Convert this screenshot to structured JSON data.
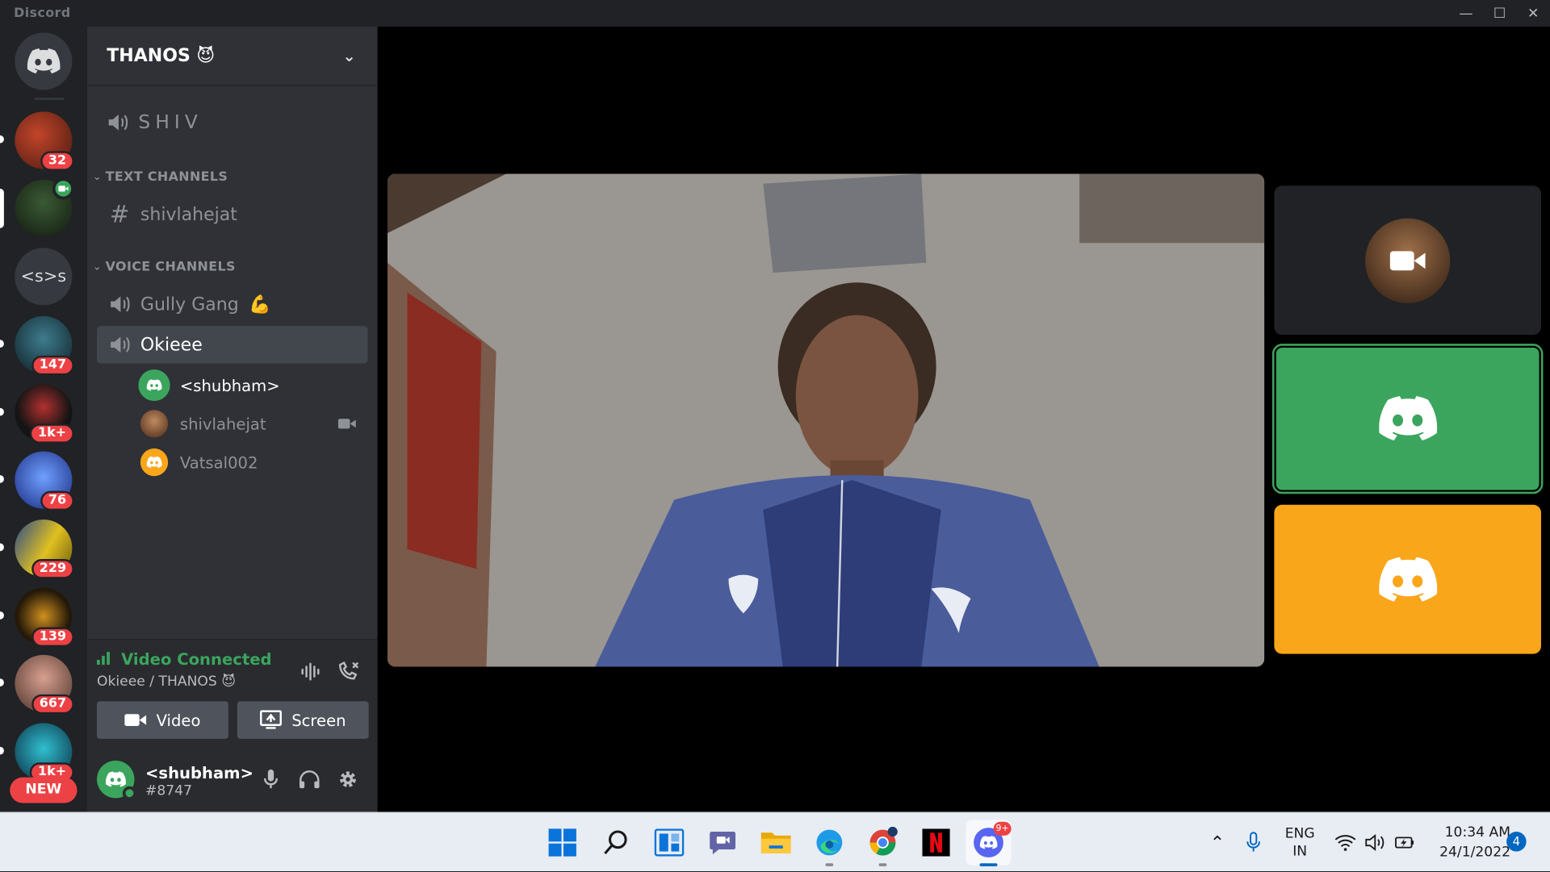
{
  "app": {
    "name": "Discord"
  },
  "window_controls": {
    "minimize": "—",
    "maximize": "☐",
    "close": "✕"
  },
  "servers": [
    {
      "badge": "32",
      "color": "#7a2a1a"
    },
    {
      "badge": "",
      "color": "#2d3b2b",
      "selected": true
    },
    {
      "label": "<s>s",
      "color": "#36393f"
    },
    {
      "badge": "147",
      "color": "#1e3a4a"
    },
    {
      "badge": "1k+",
      "color": "#2b2b2b"
    },
    {
      "badge": "76",
      "color": "#2650a8"
    },
    {
      "badge": "229",
      "color": "#c9a820"
    },
    {
      "badge": "139",
      "color": "#3a2a12"
    },
    {
      "badge": "667",
      "color": "#7a5a4a"
    },
    {
      "badge": "1k+",
      "color": "#1a6a7a"
    }
  ],
  "rail": {
    "new_label": "NEW"
  },
  "guild": {
    "name": "THANOS",
    "emoji": "😈"
  },
  "channels": {
    "top_voice": "SHIV",
    "text_category": "TEXT CHANNELS",
    "text": [
      {
        "name": "shivlahejat"
      }
    ],
    "voice_category": "VOICE CHANNELS",
    "voice": [
      {
        "name": "Gully Gang",
        "emoji": "💪"
      },
      {
        "name": "Okieee"
      }
    ],
    "voice_users": [
      {
        "name": "<shubham>",
        "avatar_color": "#3ba55d"
      },
      {
        "name": "shivlahejat",
        "avatar_color": "#7a4a2a",
        "video": true
      },
      {
        "name": "Vatsal002",
        "avatar_color": "#faa61a"
      }
    ]
  },
  "voice_panel": {
    "status": "Video Connected",
    "location": "Okieee / THANOS",
    "location_emoji": "😈",
    "video_label": "Video",
    "screen_label": "Screen"
  },
  "user_panel": {
    "name": "<shubham>",
    "tag": "#8747"
  },
  "tiles": [
    {
      "color": "#202225"
    },
    {
      "color": "#3ba55d",
      "speaking": true
    },
    {
      "color": "#faa61a"
    }
  ],
  "taskbar": {
    "lang_top": "ENG",
    "lang_bottom": "IN",
    "time": "10:34 AM",
    "date": "24/1/2022",
    "notifications": "4",
    "discord_badge": "9+"
  },
  "colors": {
    "accent_green": "#3ba55d",
    "accent_orange": "#faa61a",
    "badge_red": "#ed4245",
    "blurple": "#5865f2"
  }
}
